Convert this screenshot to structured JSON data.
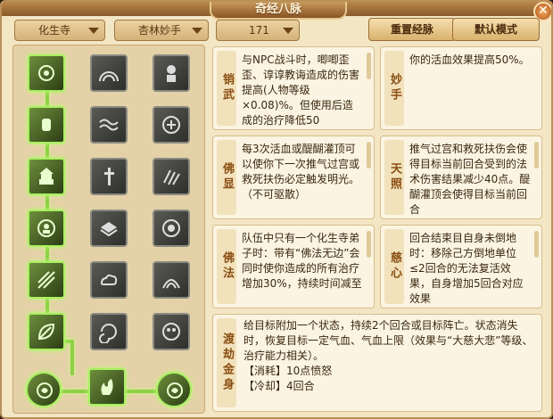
{
  "window": {
    "title": "奇经八脉",
    "close_label": "✕"
  },
  "toolbar": {
    "school": "化生寺",
    "style": "杏林妙手",
    "points": "171",
    "reset_label": "重置经脉",
    "default_label": "默认模式"
  },
  "talents": [
    {
      "name": "销武",
      "desc": "与NPC战斗时，唧唧歪歪、谆谆教诲造成的伤害提高(人物等级×0.08)%。但使用后造成的治疗降低50"
    },
    {
      "name": "妙手",
      "desc": "你的活血效果提高50%。"
    },
    {
      "name": "佛显",
      "desc": "每3次活血或醍醐灌顶可以使你下一次推气过宫或救死扶伤必定触发明光。（不可驱散）"
    },
    {
      "name": "天照",
      "desc": "推气过宫和救死扶伤会使得目标当前回合受到的法术伤害结果减少40点。醍醐灌顶会使得目标当前回合"
    },
    {
      "name": "佛法",
      "desc": "队伍中只有一个化生寺弟子时：带有“佛法无边”会同时使你造成的所有治疗增加30%，持续时间减至"
    },
    {
      "name": "慈心",
      "desc": "回合结束目自身未倒地时：移除己方倒地单位≤2回合的无法复活效果，自身增加5回合对应效果"
    },
    {
      "name": "渡劫金身",
      "desc": "给目标附加一个状态，持续2个回合或目标阵亡。状态消失时，恢复目标一定气血、气血上限（效果与“大慈大悲”等级、治疗能力相关）。",
      "cost": "【消耗】10点愤怒",
      "cooldown": "【冷却】4回合"
    }
  ],
  "icons": [
    "lotus-icon",
    "rainbow-icon",
    "monk-silhouette-icon",
    "hand-icon",
    "wave-icon",
    "dragon-icon",
    "pagoda-icon",
    "sword-icon",
    "claw-icon",
    "buddha-icon",
    "book-icon",
    "face-icon",
    "rays-icon",
    "cloud-icon",
    "robe-icon",
    "leaf-icon",
    "swirl-icon",
    "mask-icon",
    "coin-left-icon",
    "flame-hand-icon",
    "coin-right-icon"
  ],
  "colors": {
    "active_glow": "#a8f060",
    "panel_bg": "#f3e6c5",
    "accent": "#8a4e12"
  }
}
